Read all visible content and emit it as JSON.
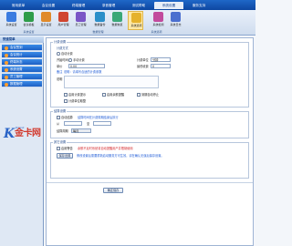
{
  "menu": {
    "tabs": [
      "常用菜单",
      "会议设置",
      "终端管理",
      "录音管理",
      "测试帮助",
      "系统设置",
      "服务支持"
    ],
    "active_index": 5
  },
  "toolbar": {
    "tools": [
      {
        "label": "系统设置",
        "icon": "settings-icon",
        "color": "#3a7be0"
      },
      {
        "label": "会议模板",
        "icon": "template-icon",
        "color": "#2f9d4a"
      },
      {
        "label": "显示设置",
        "icon": "display-icon",
        "color": "#e08a2a"
      },
      {
        "label": "用户管理",
        "icon": "users-icon",
        "color": "#d0452f"
      },
      {
        "label": "员工管理",
        "icon": "staff-icon",
        "color": "#7a55c6"
      },
      {
        "label": "数据备份",
        "icon": "backup-icon",
        "color": "#2b8fc9"
      },
      {
        "label": "数据恢复",
        "icon": "restore-icon",
        "color": "#3aa878"
      },
      {
        "label": "系统选项",
        "icon": "options-icon",
        "color": "#e5b22c"
      },
      {
        "label": "系统检测",
        "icon": "check-icon",
        "color": "#c24b9d"
      },
      {
        "label": "系统日志",
        "icon": "log-icon",
        "color": "#4b6fcf"
      }
    ],
    "selected_index": 7,
    "groups": [
      "系统设置",
      "数据管理",
      "系统选项"
    ]
  },
  "sidebar": {
    "title": "快速菜单",
    "items": [
      "会议签到",
      "会议统计",
      "终端状态",
      "系统设置",
      "员工管理",
      "数据管理"
    ]
  },
  "logo": {
    "letter": "K",
    "text": "金卡网",
    "small": "Kbzgnet"
  },
  "form": {
    "section1": "计费设置",
    "sub1": "计费方式",
    "opt_auto": "自动计费",
    "opt_manual": "手动计费",
    "start_label": "开始时间",
    "start_value": "00:00",
    "unit_label": "计费单位",
    "unit_value": "分钟",
    "price_label": "单价",
    "price_value": "0.00",
    "min_label": "最低收费",
    "min_value": "0",
    "note_hint": "说明：请填写合适的计费参数",
    "notice_label": "备注",
    "area_label": "说明",
    "chk_a": "启用计费提示",
    "chk_b": "启用余额提醒",
    "chk_c": "到期自动停止",
    "chk_d": "计费单位取整",
    "section2": "结算设置",
    "auto_settle": "自动结算",
    "settle_hint": "结算时间在计费周期结束后执行",
    "settle_from": "从",
    "settle_to": "至",
    "period_label": "结算周期",
    "period_value": "每月",
    "section3": "其它设置",
    "chk_warn": "启用警告",
    "warn_text": "余额不足时系统将自动提醒用户并限制使用",
    "footer_hint": "修改设置后需要重新启动服务方可生效，请在确认无误后保存设置。",
    "save_btn": "保存设置",
    "ok_btn": "确定保存"
  }
}
